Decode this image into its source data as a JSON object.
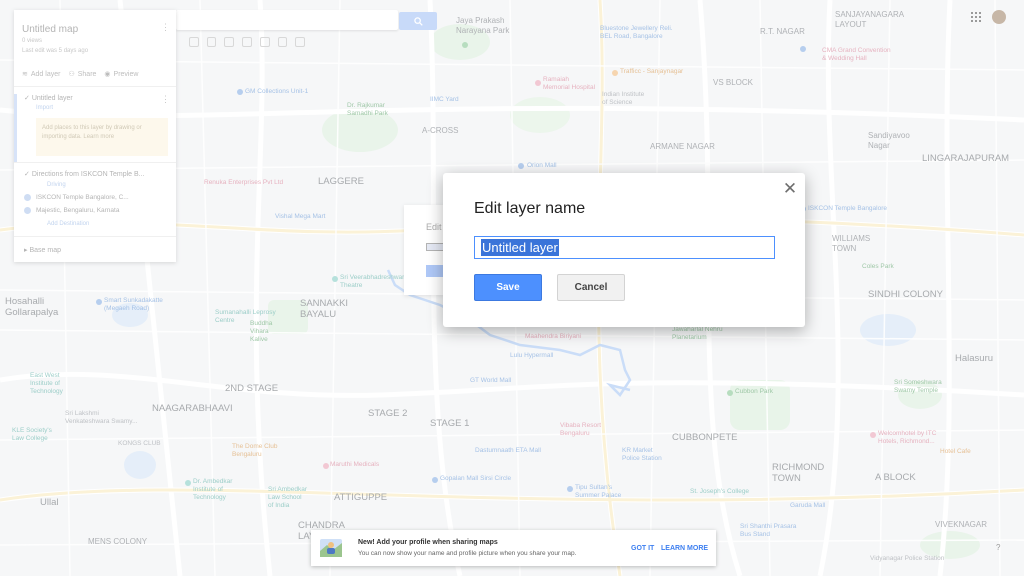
{
  "left_panel": {
    "map_title": "Untitled map",
    "views": "0 views",
    "last_edit": "Last edit was 5 days ago",
    "actions": {
      "add_layer": "Add layer",
      "share": "Share",
      "preview": "Preview"
    },
    "layers": [
      {
        "name": "Untitled layer",
        "style": "Import",
        "hint": "Add places to this layer by drawing or importing data. Learn more"
      },
      {
        "name": "Directions from ISKCON Temple B...",
        "mode": "Driving",
        "stops": [
          "ISKCON Temple Bangalore, C...",
          "Majestic, Bengaluru, Karnata"
        ],
        "add_destination": "Add Destination"
      }
    ],
    "base_map": "Base map"
  },
  "dialog": {
    "title": "Edit layer name",
    "input_value": "Untitled layer",
    "save_label": "Save",
    "cancel_label": "Cancel",
    "close_glyph": "✕"
  },
  "ghost_dialog": {
    "title": "Edit"
  },
  "notification": {
    "headline": "New! Add your profile when sharing maps",
    "body": "You can now show your name and profile picture when you share your map.",
    "got_it": "GOT IT",
    "learn_more": "LEARN MORE"
  },
  "help_glyph": "?",
  "map_labels": [
    "Jaya Prakash\nNarayana Park",
    "Bluestone Jewellery Reli.\nBEL Road, Bangalore",
    "R.T. NAGAR",
    "SANJAYANAGARA\nLAYOUT",
    "Ramaiah\nMemorial Hospital",
    "Trafficc - Sanjaynagar",
    "CMA Grand Convention\n& Wedding Hall",
    "GM Collections Unit-1",
    "Indian Institute\nof Science",
    "VS BLOCK",
    "Dr. Rajkumar\nSamadhi Park",
    "IIMC Yard",
    "A-CROSS",
    "ARMANE NAGAR",
    "Sandiyavoo\nNagar",
    "LINGARAJAPURAM",
    "LAGGERE",
    "Orion Mall",
    "Renuka Enterprises Pvt Ltd",
    "Vishal Mega Mart",
    "ISKCON Temple Bangalore",
    "WILLIAMS\nTOWN",
    "Coles Park",
    "Sri Veerabhadreshwara\nTheatre",
    "SANNAKKI\nBAYALU",
    "Hosahalli\nGollarapalya",
    "Smart Sunkadakatte\n(Megaeh Road)",
    "SINDHI COLONY",
    "Sumanahalli Leprosy\nCentre",
    "Buddha\nVihara\nKalive",
    "Maahendra Biriyani",
    "Jawaharlal Nehru\nPlanetarium",
    "Lulu Hypermall",
    "Halasuru",
    "2ND STAGE",
    "GT World Mall",
    "Cubbon Park",
    "Sri Someshwara\nSwamy Temple",
    "East West\nInstitute of\nTechnology",
    "NAAGARABHAAVI",
    "STAGE 2",
    "STAGE 1",
    "CUBBONPETE",
    "Sri Lakshmi\nVenkateshwara Swamy...",
    "KLE Society's\nLaw College",
    "KONGS CLUB",
    "The Dome Club\nBengaluru",
    "Dastumnaath ETA Mall",
    "KR Market\nPolice Station",
    "Vibaba Resort\nBengaluru",
    "Welcomhotel by ITC\nHotels, Richmond...",
    "Maruthi Medicals",
    "Dr. Ambedkar\nInstitute of\nTechnology",
    "Sri Ambedkar\nLaw School\nof India",
    "Gopalan Mall Sirsi Circle",
    "Tipu Sultan's\nSummer Palace",
    "St. Joseph's College",
    "RICHMOND\nTOWN",
    "Garuda Mall",
    "Ullal",
    "ATTIGUPPE",
    "CHANDRA\nLAYOUT",
    "A BLOCK",
    "Sri Shanthi Prasara\nBus Stand",
    "VIVEKNAGAR",
    "MENS COLONY",
    "Vidyanagar Police Station",
    "Hotel Cafe"
  ]
}
